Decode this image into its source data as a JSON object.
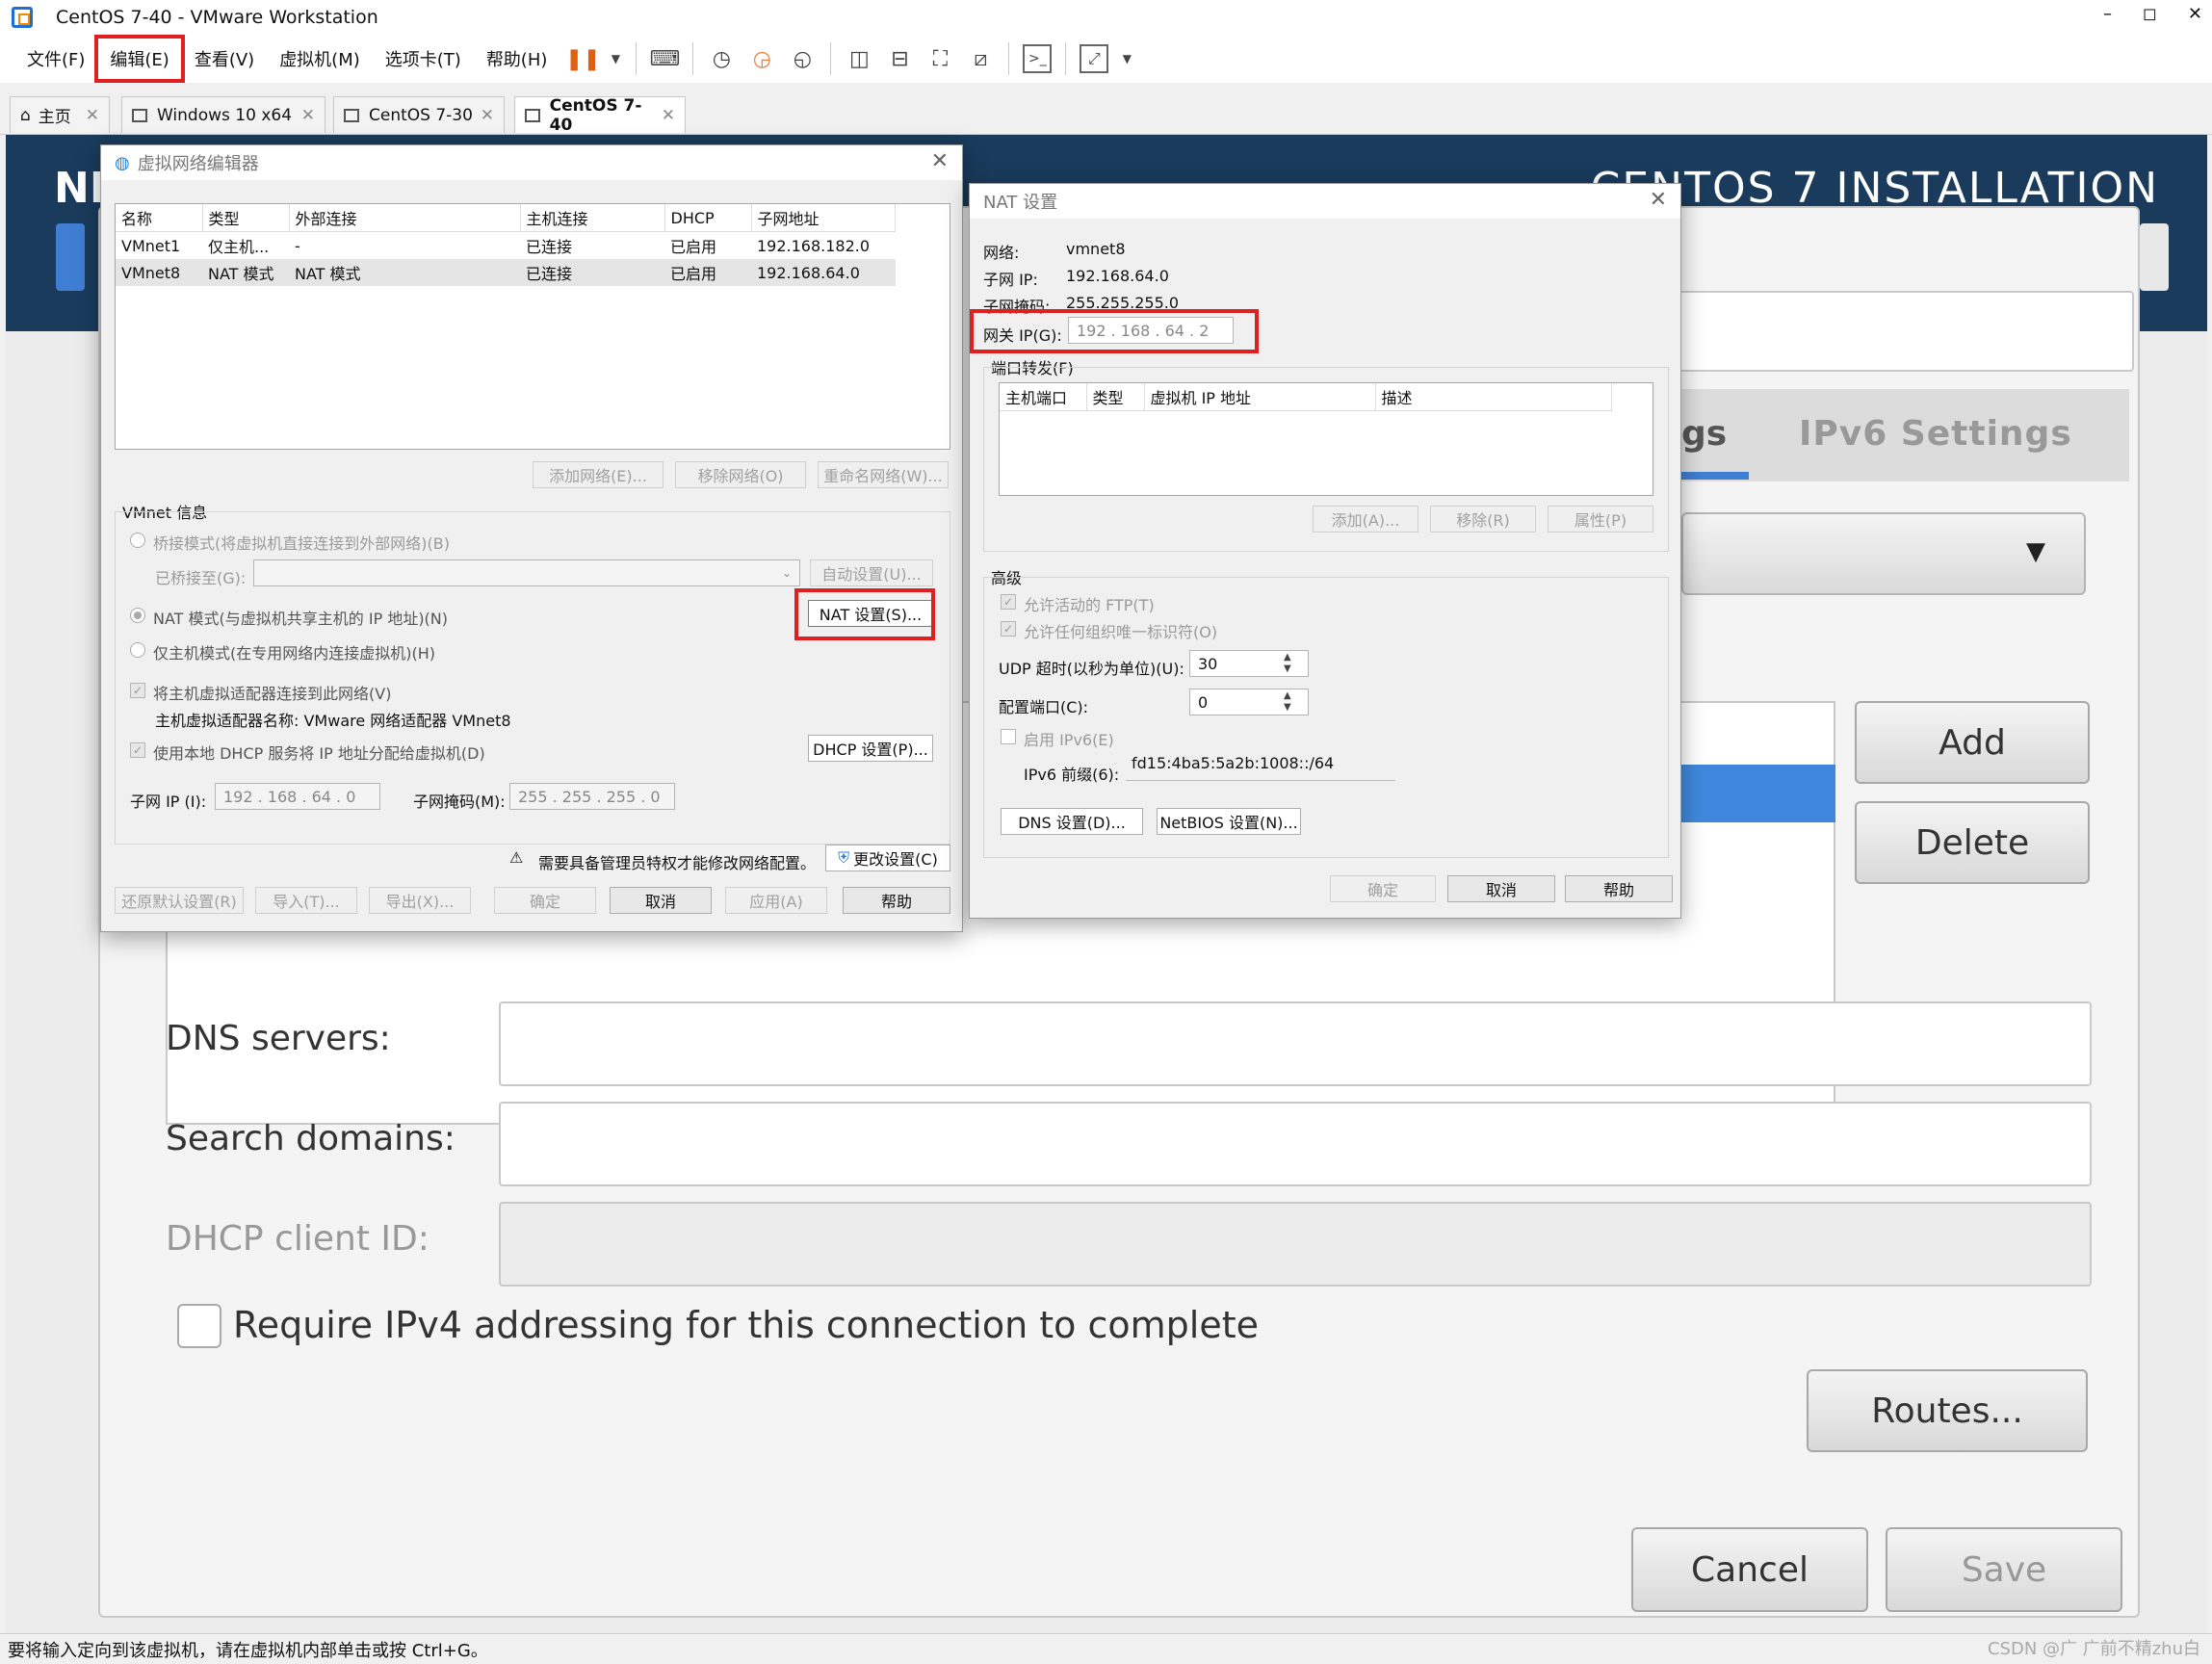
{
  "window": {
    "title": "CentOS 7-40 - VMware Workstation",
    "min": "–",
    "max": "◻",
    "close": "✕"
  },
  "menu": [
    "文件(F)",
    "编辑(E)",
    "查看(V)",
    "虚拟机(M)",
    "选项卡(T)",
    "帮助(H)"
  ],
  "tabs": [
    {
      "label": "主页",
      "x": "✕"
    },
    {
      "label": "Windows 10 x64",
      "x": "✕"
    },
    {
      "label": "CentOS 7-30",
      "x": "✕"
    },
    {
      "label": "CentOS 7-40",
      "x": "✕"
    }
  ],
  "vm": {
    "banner_left": "NE",
    "banner_title": "CENTOS 7 INSTALLATION",
    "tab_partial": "gs",
    "tab_ipv6": "IPv6 Settings",
    "dropdown_arrow": "▼",
    "add": "Add",
    "delete": "Delete",
    "dns_label": "DNS servers:",
    "search_label": "Search domains:",
    "dhcp_label": "DHCP client ID:",
    "require_label": "Require IPv4 addressing for this connection to complete",
    "routes": "Routes...",
    "cancel": "Cancel",
    "save": "Save"
  },
  "vne": {
    "title": "虚拟网络编辑器",
    "close": "✕",
    "columns": [
      "名称",
      "类型",
      "外部连接",
      "主机连接",
      "DHCP",
      "子网地址"
    ],
    "rows": [
      [
        "VMnet1",
        "仅主机...",
        "-",
        "已连接",
        "已启用",
        "192.168.182.0"
      ],
      [
        "VMnet8",
        "NAT 模式",
        "NAT 模式",
        "已连接",
        "已启用",
        "192.168.64.0"
      ]
    ],
    "add_network": "添加网络(E)...",
    "remove_network": "移除网络(O)",
    "rename_network": "重命名网络(W)...",
    "vmnet_info": "VMnet 信息",
    "bridge_mode": "桥接模式(将虚拟机直接连接到外部网络)(B)",
    "bridged_to": "已桥接至(G):",
    "auto_settings": "自动设置(U)...",
    "nat_mode": "NAT 模式(与虚拟机共享主机的 IP 地址)(N)",
    "nat_settings": "NAT 设置(S)...",
    "host_only": "仅主机模式(在专用网络内连接虚拟机)(H)",
    "connect_adapter": "将主机虚拟适配器连接到此网络(V)",
    "adapter_name": "主机虚拟适配器名称: VMware 网络适配器 VMnet8",
    "use_dhcp": "使用本地 DHCP 服务将 IP 地址分配给虚拟机(D)",
    "dhcp_settings": "DHCP 设置(P)...",
    "subnet_ip_label": "子网 IP (I):",
    "subnet_ip": "192 . 168 . 64 . 0",
    "mask_label": "子网掩码(M):",
    "mask": "255 . 255 . 255 . 0",
    "admin_warning": "需要具备管理员特权才能修改网络配置。",
    "change_settings": "更改设置(C)",
    "restore": "还原默认设置(R)",
    "import": "导入(T)...",
    "export": "导出(X)...",
    "ok": "确定",
    "cancel": "取消",
    "apply": "应用(A)",
    "help": "帮助"
  },
  "nat": {
    "title": "NAT 设置",
    "close": "✕",
    "network_label": "网络:",
    "network": "vmnet8",
    "subnet_ip_label": "子网 IP:",
    "subnet_ip": "192.168.64.0",
    "mask_label": "子网掩码:",
    "mask": "255.255.255.0",
    "gateway_label": "网关 IP(G):",
    "gateway": "192 . 168 . 64 . 2",
    "port_forward": "端口转发(F)",
    "pf_columns": [
      "主机端口",
      "类型",
      "虚拟机 IP 地址",
      "描述"
    ],
    "add": "添加(A)...",
    "remove": "移除(R)",
    "props": "属性(P)",
    "advanced": "高级",
    "allow_ftp": "允许活动的 FTP(T)",
    "allow_oui": "允许任何组织唯一标识符(O)",
    "udp_label": "UDP 超时(以秒为单位)(U):",
    "udp": "30",
    "config_port_label": "配置端口(C):",
    "config_port": "0",
    "enable_ipv6": "启用 IPv6(E)",
    "ipv6_prefix_label": "IPv6 前缀(6):",
    "ipv6_prefix": "fd15:4ba5:5a2b:1008::/64",
    "dns_settings": "DNS 设置(D)...",
    "netbios_settings": "NetBIOS 设置(N)...",
    "ok": "确定",
    "cancel": "取消",
    "help": "帮助"
  },
  "status": "要将输入定向到该虚拟机，请在虚拟机内部单击或按 Ctrl+G。",
  "watermark": "CSDN @广 广前不精zhu白"
}
